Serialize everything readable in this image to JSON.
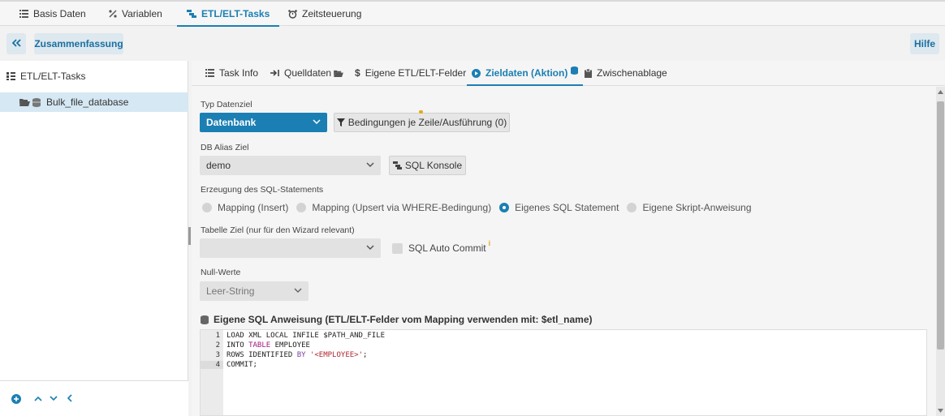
{
  "top_tabs": [
    {
      "label": "Basis Daten",
      "icon": "list-icon"
    },
    {
      "label": "Variablen",
      "icon": "percent-icon"
    },
    {
      "label": "ETL/ELT-Tasks",
      "icon": "etl-icon"
    },
    {
      "label": "Zeitsteuerung",
      "icon": "alarm-clock-icon"
    }
  ],
  "actionbar": {
    "collapse_icon": "double-chevron-left-icon",
    "summary_label": "Zusammenfassung",
    "help_label": "Hilfe"
  },
  "tree": {
    "root_label": "ETL/ELT-Tasks",
    "node_label": "Bulk_file_database"
  },
  "sub_tabs": [
    {
      "label": "Task Info",
      "icon": "list-icon"
    },
    {
      "label": "Quelldaten",
      "icon": "arrow-in-icon"
    },
    {
      "label": "Eigene ETL/ELT-Felder",
      "icon": "dollar-icon"
    },
    {
      "label": "Zieldaten (Aktion)",
      "icon": "play-circle-icon"
    },
    {
      "label": "Zwischenablage",
      "icon": "clipboard-icon"
    }
  ],
  "form": {
    "typ_label": "Typ Datenziel",
    "typ_value": "Datenbank",
    "bedingungen_label": "Bedingungen je Zeile/Ausführung (0)",
    "db_alias_label": "DB Alias Ziel",
    "db_alias_value": "demo",
    "sql_konsole_label": "SQL Konsole",
    "erzeugung_label": "Erzeugung des SQL-Statements",
    "radios": [
      {
        "label": "Mapping (Insert)",
        "checked": false
      },
      {
        "label": "Mapping (Upsert via WHERE-Bedingung)",
        "checked": false
      },
      {
        "label": "Eigenes SQL Statement",
        "checked": true
      },
      {
        "label": "Eigene Skript-Anweisung",
        "checked": false
      }
    ],
    "tabelle_label": "Tabelle Ziel (nur für den Wizard relevant)",
    "tabelle_value": "",
    "auto_commit_label": "SQL Auto Commit",
    "auto_commit_checked": false,
    "null_label": "Null-Werte",
    "null_value": "Leer-String",
    "sql_heading": "Eigene SQL Anweisung (ETL/ELT-Felder vom Mapping verwenden mit: $etl_name)"
  },
  "editor": {
    "line_numbers": [
      "1",
      "2",
      "3",
      "4"
    ],
    "lines": [
      "LOAD XML LOCAL INFILE $PATH_AND_FILE",
      "INTO TABLE EMPLOYEE",
      "ROWS IDENTIFIED BY '<EMPLOYEE>';",
      "COMMIT;"
    ]
  },
  "colors": {
    "accent": "#1b7fb3",
    "selection": "#d5e8f3"
  }
}
